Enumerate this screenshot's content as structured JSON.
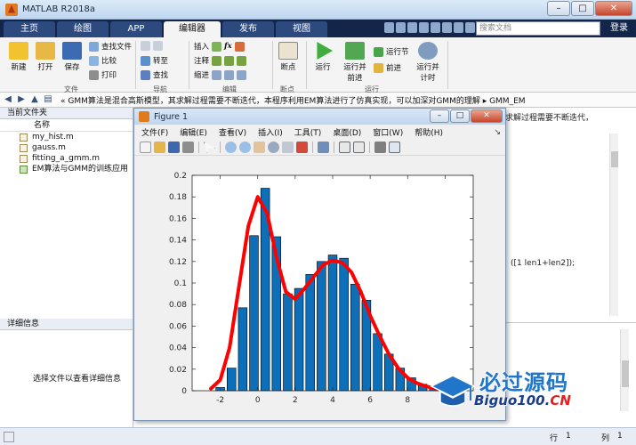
{
  "app": {
    "title": "MATLAB R2018a"
  },
  "tabs": [
    {
      "label": "主页"
    },
    {
      "label": "绘图"
    },
    {
      "label": "APP"
    },
    {
      "label": "编辑器"
    },
    {
      "label": "发布"
    },
    {
      "label": "视图"
    }
  ],
  "search": {
    "placeholder": "搜索文档"
  },
  "login": "登录",
  "ribbon": {
    "file_group": {
      "label": "文件",
      "new": "新建",
      "open": "打开",
      "save": "保存",
      "find_files": "查找文件",
      "compare": "比较",
      "print": "打印"
    },
    "nav_group": {
      "label": "导航",
      "goto": "转至",
      "find": "查找"
    },
    "edit_group": {
      "label": "编辑",
      "insert": "插入",
      "comment": "注释",
      "indent": "缩进"
    },
    "breakpoint_group": {
      "label": "断点",
      "breakpoints": "断点"
    },
    "run_group": {
      "label": "运行",
      "run": "运行",
      "run_advance_line1": "运行并",
      "run_advance_line2": "前进",
      "run_section": "运行节",
      "advance": "前进",
      "run_time_line1": "运行并",
      "run_time_line2": "计时"
    }
  },
  "address": {
    "path": "« GMM算法是混合高斯模型，其求解过程需要不断迭代，本程序利用EM算法进行了仿真实现，可以加深对GMM的理解 ▸ GMM_EM"
  },
  "current_folder": {
    "title": "当前文件夹",
    "column_name": "名称",
    "files": [
      {
        "name": "my_hist.m"
      },
      {
        "name": "gauss.m"
      },
      {
        "name": "fitting_a_gmm.m"
      },
      {
        "name": "EM算法与GMM的训练应用"
      }
    ]
  },
  "details": {
    "title": "详细信息",
    "hint": "选择文件以查看详细信息"
  },
  "editor": {
    "line1": "求解过程需要不断迭代，",
    "line2": "([1 len1+len2]);"
  },
  "status": {
    "row_label": "行",
    "row_value": "1",
    "col_label": "列",
    "col_value": "1"
  },
  "figure": {
    "title": "Figure 1",
    "menu": [
      "文件(F)",
      "编辑(E)",
      "查看(V)",
      "插入(I)",
      "工具(T)",
      "桌面(D)",
      "窗口(W)",
      "帮助(H)"
    ]
  },
  "chart_data": {
    "type": "bar",
    "title": "",
    "xlabel": "",
    "ylabel": "",
    "xlim": [
      -3.5,
      11.5
    ],
    "ylim": [
      0,
      0.2
    ],
    "xticks": [
      -2,
      0,
      2,
      4,
      6,
      8,
      10
    ],
    "yticks": [
      0,
      0.02,
      0.04,
      0.06,
      0.08,
      0.1,
      0.12,
      0.14,
      0.16,
      0.18,
      0.2
    ],
    "bar_color": "#0d6fb8",
    "bar_width": 0.78,
    "series": [
      {
        "type": "bar",
        "x": [
          -2.0,
          -1.4,
          -0.8,
          -0.2,
          0.4,
          1.0,
          1.6,
          2.2,
          2.8,
          3.4,
          4.0,
          4.6,
          5.2,
          5.8,
          6.4,
          7.0,
          7.6,
          8.2,
          8.8,
          9.4
        ],
        "values": [
          0.003,
          0.021,
          0.077,
          0.144,
          0.188,
          0.143,
          0.09,
          0.095,
          0.108,
          0.12,
          0.126,
          0.123,
          0.099,
          0.084,
          0.053,
          0.034,
          0.021,
          0.012,
          0.006,
          0.002
        ]
      },
      {
        "type": "line",
        "color": "#ff0000",
        "x": [
          -2.5,
          -2.0,
          -1.5,
          -1.0,
          -0.5,
          0.0,
          0.5,
          1.0,
          1.5,
          2.0,
          2.5,
          3.0,
          3.5,
          4.0,
          4.5,
          5.0,
          5.5,
          6.0,
          6.5,
          7.0,
          7.5,
          8.0,
          8.5,
          9.0,
          9.5,
          10.0
        ],
        "values": [
          0.002,
          0.01,
          0.04,
          0.097,
          0.153,
          0.18,
          0.165,
          0.124,
          0.092,
          0.085,
          0.095,
          0.106,
          0.117,
          0.121,
          0.119,
          0.11,
          0.092,
          0.07,
          0.051,
          0.034,
          0.021,
          0.012,
          0.007,
          0.004,
          0.002,
          0.001
        ]
      }
    ]
  },
  "watermark": {
    "cn": "必过源码",
    "en_main": "Biguo100.",
    "en_red": "CN"
  }
}
